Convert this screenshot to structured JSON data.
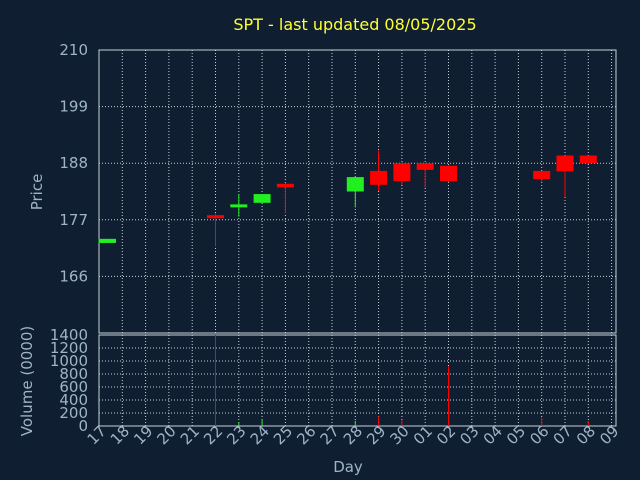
{
  "chart_data": {
    "type": "candlestick",
    "title": "SPT - last updated 08/05/2025",
    "price_panel": {
      "ylabel": "Price",
      "ylim": [
        155,
        210
      ],
      "yticks": [
        210,
        199,
        188,
        177,
        166
      ]
    },
    "volume_panel": {
      "ylabel": "Volume (0000)",
      "ylim": [
        0,
        1400
      ],
      "yticks": [
        1400,
        1200,
        1000,
        800,
        600,
        400,
        200,
        0
      ]
    },
    "xlabel": "Day",
    "x_tick_labels": [
      "17",
      "18",
      "19",
      "20",
      "21",
      "22",
      "23",
      "24",
      "25",
      "26",
      "27",
      "28",
      "29",
      "30",
      "01",
      "02",
      "03",
      "04",
      "05",
      "06",
      "07",
      "08",
      "09"
    ],
    "candles": [
      {
        "day": "17",
        "open": 172.5,
        "high": 173.3,
        "low": 172.5,
        "close": 173.3,
        "volume": 0
      },
      {
        "day": "22",
        "open": 177.9,
        "high": 178.2,
        "low": 171.8,
        "close": 177.3,
        "volume": 1400
      },
      {
        "day": "23",
        "open": 179.5,
        "high": 182.0,
        "low": 177.6,
        "close": 180.0,
        "volume": 60
      },
      {
        "day": "24",
        "open": 180.3,
        "high": 182.0,
        "low": 180.3,
        "close": 182.0,
        "volume": 100
      },
      {
        "day": "25",
        "open": 184.0,
        "high": 184.2,
        "low": 178.3,
        "close": 183.3,
        "volume": 0
      },
      {
        "day": "28",
        "open": 182.5,
        "high": 185.5,
        "low": 179.4,
        "close": 185.3,
        "volume": 80
      },
      {
        "day": "29",
        "open": 186.5,
        "high": 190.5,
        "low": 182.6,
        "close": 183.8,
        "volume": 150
      },
      {
        "day": "30",
        "open": 188.0,
        "high": 188.0,
        "low": 183.8,
        "close": 184.5,
        "volume": 90
      },
      {
        "day": "01",
        "open": 188.0,
        "high": 188.0,
        "low": 183.2,
        "close": 186.7,
        "volume": 0
      },
      {
        "day": "02",
        "open": 187.5,
        "high": 187.5,
        "low": 184.3,
        "close": 184.5,
        "volume": 920
      },
      {
        "day": "06",
        "open": 186.5,
        "high": 186.5,
        "low": 184.3,
        "close": 184.9,
        "volume": 130
      },
      {
        "day": "07",
        "open": 189.5,
        "high": 189.5,
        "low": 181.4,
        "close": 186.4,
        "volume": 0
      },
      {
        "day": "08",
        "open": 189.5,
        "high": 189.5,
        "low": 187.9,
        "close": 188.0,
        "volume": 80
      }
    ],
    "grid": true,
    "colors": {
      "background": "#0f1e30",
      "up": "#22ee22",
      "down": "#ff0000",
      "grid": "#c8d0d8",
      "text": "#9fb4c8",
      "title": "#ffff33"
    }
  }
}
